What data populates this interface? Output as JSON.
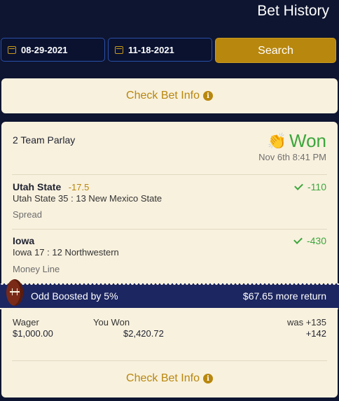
{
  "header": {
    "title": "Bet History"
  },
  "filters": {
    "start_date": "08-29-2021",
    "end_date": "11-18-2021",
    "search_label": "Search"
  },
  "top_card": {
    "check_info_label": "Check Bet Info",
    "info_glyph": "i"
  },
  "bet": {
    "type": "2 Team Parlay",
    "result_icon": "clapping-hands-icon",
    "result_emoji": "👏",
    "result": "Won",
    "datetime": "Nov 6th 8:41 PM",
    "legs": [
      {
        "team": "Utah State",
        "line": "-17.5",
        "score": "Utah State 35 : 13 New Mexico State",
        "market": "Spread",
        "odds": "-110"
      },
      {
        "team": "Iowa",
        "line": "",
        "score": "Iowa 17 : 12 Northwestern",
        "market": "Money Line",
        "odds": "-430"
      }
    ],
    "boost": {
      "label": "Odd Boosted by 5%",
      "extra_return": "$67.65 more return"
    },
    "wager_label": "Wager",
    "wager": "$1,000.00",
    "won_label": "You Won",
    "won_amount": "$2,420.72",
    "was_odds": "was +135",
    "new_odds": "+142",
    "check_info_label": "Check Bet Info",
    "info_glyph": "i"
  },
  "colors": {
    "background": "#0e1530",
    "accent_gold": "#b8870d",
    "won_green": "#3da63d",
    "card": "#f8f1de",
    "boost_bar": "#1c2660"
  }
}
